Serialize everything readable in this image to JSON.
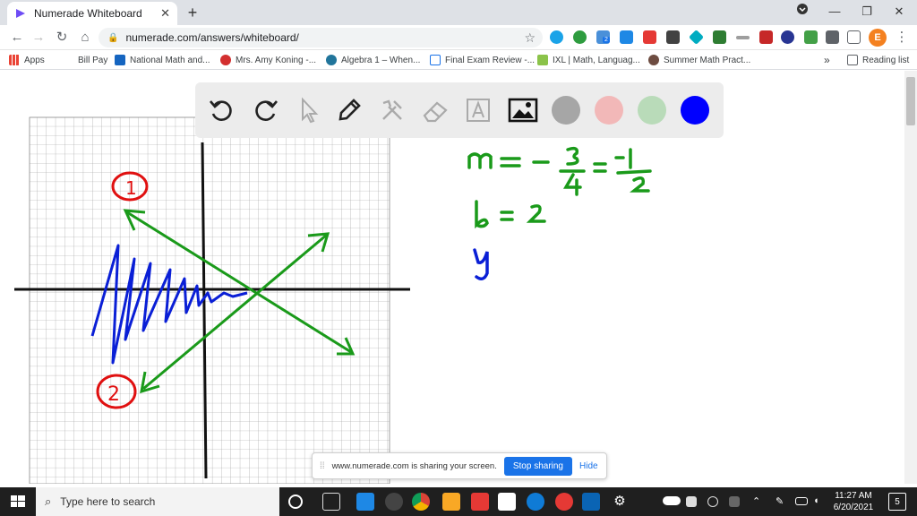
{
  "browser": {
    "tab_title": "Numerade Whiteboard",
    "url": "numerade.com/answers/whiteboard/",
    "profile_initial": "E",
    "extension_badge": "2"
  },
  "bookmarks": {
    "items": [
      {
        "label": "Apps",
        "color": "#4285f4"
      },
      {
        "label": "Bill Pay",
        "color": "#ffffff"
      },
      {
        "label": "National Math and...",
        "color": "#1565c0"
      },
      {
        "label": "Mrs. Amy Koning -...",
        "color": "#d32f2f"
      },
      {
        "label": "Algebra 1 – When...",
        "color": "#21759b"
      },
      {
        "label": "Final Exam Review -...",
        "color": "#1a73e8"
      },
      {
        "label": "IXL | Math, Languag...",
        "color": "#8bc34a"
      },
      {
        "label": "Summer Math Pract...",
        "color": "#6d4c41"
      }
    ],
    "more": "»",
    "reading_list": "Reading list"
  },
  "whiteboard": {
    "tools": [
      "undo-icon",
      "redo-icon",
      "select-icon",
      "pen-icon",
      "tools-icon",
      "eraser-icon",
      "text-icon",
      "image-icon"
    ],
    "colors": [
      "#a6a6a6",
      "#f2b8b8",
      "#b9dbb9",
      "#0000ff"
    ],
    "selected_color": "#0000ff",
    "handwriting": {
      "m_line": "m = − 3/4 = −1/2",
      "b_line": "b = 2",
      "y_line": "y",
      "circle_1": "1",
      "circle_2": "2"
    }
  },
  "sharing_bar": {
    "message": "www.numerade.com is sharing your screen.",
    "stop_label": "Stop sharing",
    "hide_label": "Hide"
  },
  "taskbar": {
    "search_placeholder": "Type here to search",
    "time": "11:27 AM",
    "date": "6/20/2021",
    "notification_count": "5"
  }
}
